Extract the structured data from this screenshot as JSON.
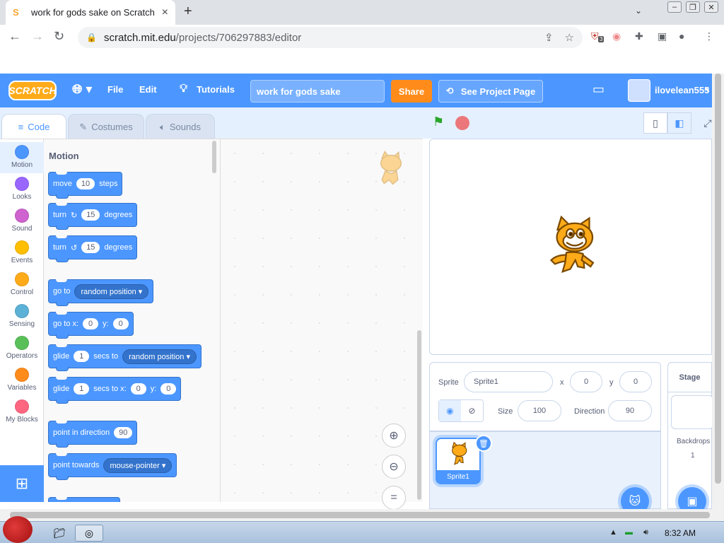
{
  "browser": {
    "tab_title": "work for gods sake on Scratch",
    "url_domain": "scratch.mit.edu",
    "url_path": "/projects/706297883/editor",
    "ext_badge": "3"
  },
  "menubar": {
    "logo": "SCRATCH",
    "file": "File",
    "edit": "Edit",
    "tutorials": "Tutorials",
    "project_title": "work for gods sake",
    "share": "Share",
    "see_project": "See Project Page",
    "username": "ilovelean555"
  },
  "tabs": {
    "code": "Code",
    "costumes": "Costumes",
    "sounds": "Sounds"
  },
  "categories": [
    {
      "label": "Motion",
      "color": "#4c97ff"
    },
    {
      "label": "Looks",
      "color": "#9966ff"
    },
    {
      "label": "Sound",
      "color": "#cf63cf"
    },
    {
      "label": "Events",
      "color": "#ffbf00"
    },
    {
      "label": "Control",
      "color": "#ffab19"
    },
    {
      "label": "Sensing",
      "color": "#5cb1d6"
    },
    {
      "label": "Operators",
      "color": "#59c059"
    },
    {
      "label": "Variables",
      "color": "#ff8c1a"
    },
    {
      "label": "My Blocks",
      "color": "#ff6680"
    }
  ],
  "palette": {
    "title": "Motion",
    "move": {
      "label": "move",
      "value": "10",
      "suffix": "steps"
    },
    "turn_cw": {
      "label": "turn",
      "value": "15",
      "suffix": "degrees"
    },
    "turn_ccw": {
      "label": "turn",
      "value": "15",
      "suffix": "degrees"
    },
    "goto": {
      "label": "go to",
      "option": "random position"
    },
    "goto_xy": {
      "label": "go to x:",
      "x": "0",
      "ylabel": "y:",
      "y": "0"
    },
    "glide": {
      "label": "glide",
      "value": "1",
      "mid": "secs to",
      "option": "random position"
    },
    "glide_xy": {
      "label": "glide",
      "value": "1",
      "mid": "secs to x:",
      "x": "0",
      "ylabel": "y:",
      "y": "0"
    },
    "point_dir": {
      "label": "point in direction",
      "value": "90"
    },
    "point_towards": {
      "label": "point towards",
      "option": "mouse-pointer"
    }
  },
  "sprite_info": {
    "sprite_label": "Sprite",
    "sprite_name": "Sprite1",
    "x_label": "x",
    "x": "0",
    "y_label": "y",
    "y": "0",
    "size_label": "Size",
    "size": "100",
    "direction_label": "Direction",
    "direction": "90"
  },
  "sprite_list": [
    {
      "name": "Sprite1"
    }
  ],
  "stage_pane": {
    "title": "Stage",
    "backdrops_label": "Backdrops",
    "backdrops_count": "1"
  },
  "taskbar": {
    "time": "8:32 AM"
  }
}
